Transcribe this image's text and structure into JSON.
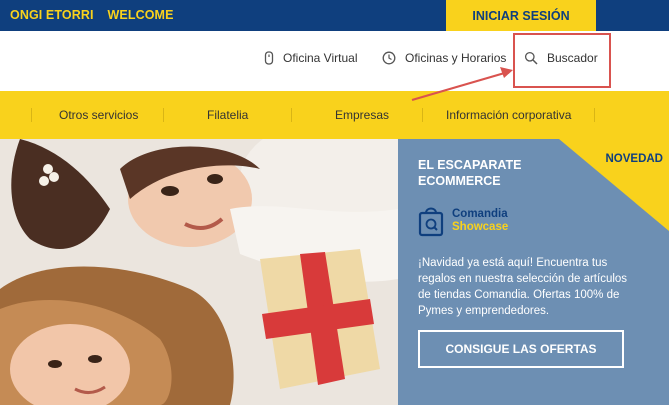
{
  "topbar": {
    "welcome_part1": "ONGI ETORRI",
    "welcome_part2": "WELCOME",
    "login_label": "INICIAR SESIÓN"
  },
  "utility": {
    "virtual_office": "Oficina Virtual",
    "offices_hours": "Oficinas y Horarios",
    "search": "Buscador"
  },
  "nav": {
    "items": [
      "Otros servicios",
      "Filatelia",
      "Empresas",
      "Información corporativa"
    ]
  },
  "promo": {
    "badge": "NOVEDAD",
    "title": "EL ESCAPARATE ECOMMERCE",
    "logo_line1": "Comandia",
    "logo_line2": "Showcase",
    "body": "¡Navidad ya está aquí! Encuentra tus regalos en nuestra selección de artículos de tiendas Comandia. Ofertas 100% de Pymes y emprendedores.",
    "cta": "CONSIGUE LAS OFERTAS"
  },
  "colors": {
    "brand_blue": "#0f3f7e",
    "brand_yellow": "#f9d21c",
    "panel_blue": "#6d8fb3",
    "highlight_red": "#d9534f"
  }
}
